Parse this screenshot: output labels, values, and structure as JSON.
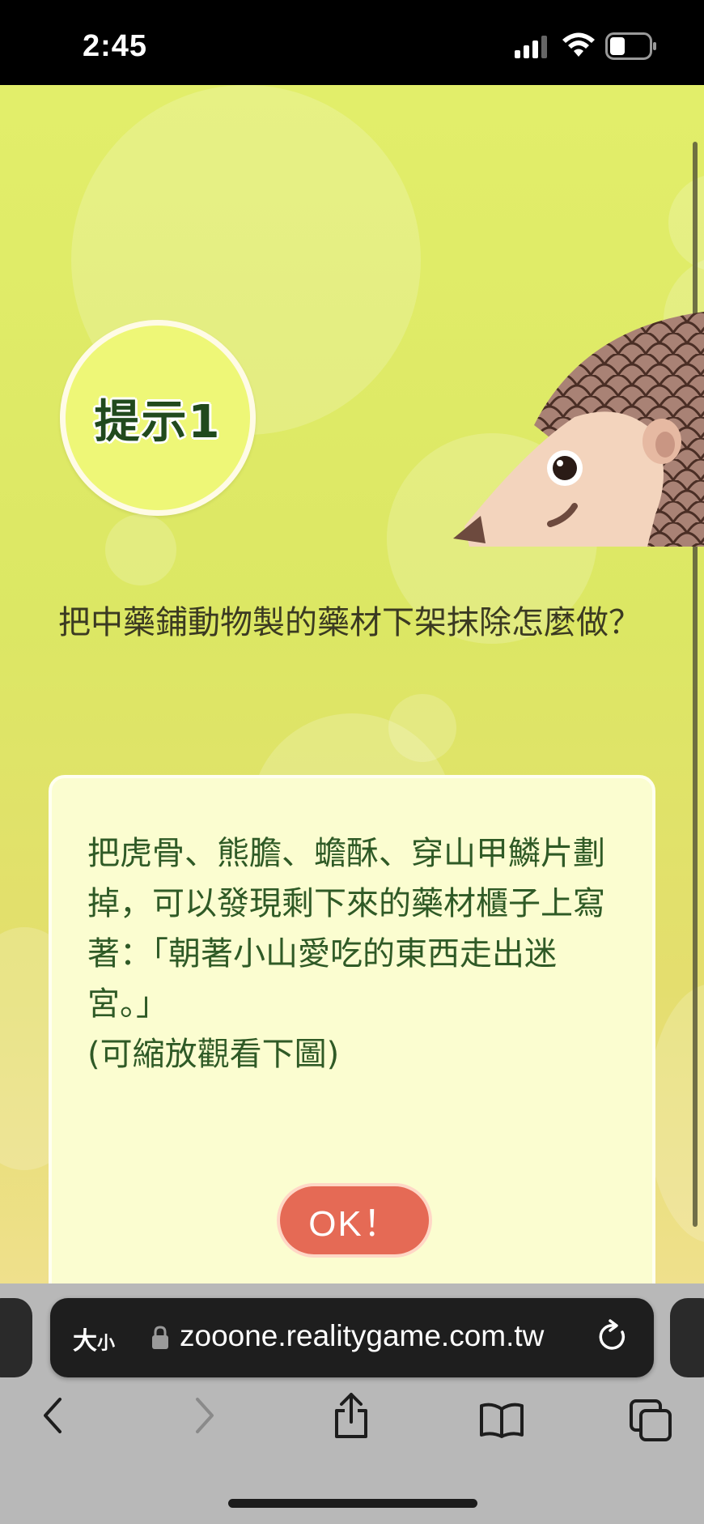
{
  "status_bar": {
    "time": "2:45"
  },
  "game": {
    "hint_badge": "提示1",
    "question": "把中藥鋪動物製的藥材下架抹除怎麼做？",
    "answer": "把虎骨、熊膽、蟾酥、穿山甲鱗片劃掉，可以發現剩下來的藥材櫃子上寫著：「朝著小山愛吃的東西走出迷宮。」\n(可縮放觀看下圖)",
    "ok_label": "OK！",
    "colors": {
      "background": "#dce764",
      "card": "#fbfdd0",
      "answer_text": "#2f5a26",
      "ok_button": "#e56a55"
    }
  },
  "browser": {
    "text_size_label": "大",
    "text_size_small": "小",
    "url": "zooone.realitygame.com.tw",
    "icons": [
      "lock-icon",
      "reload-icon",
      "back-icon",
      "forward-icon",
      "share-icon",
      "bookmarks-icon",
      "tabs-icon"
    ]
  }
}
